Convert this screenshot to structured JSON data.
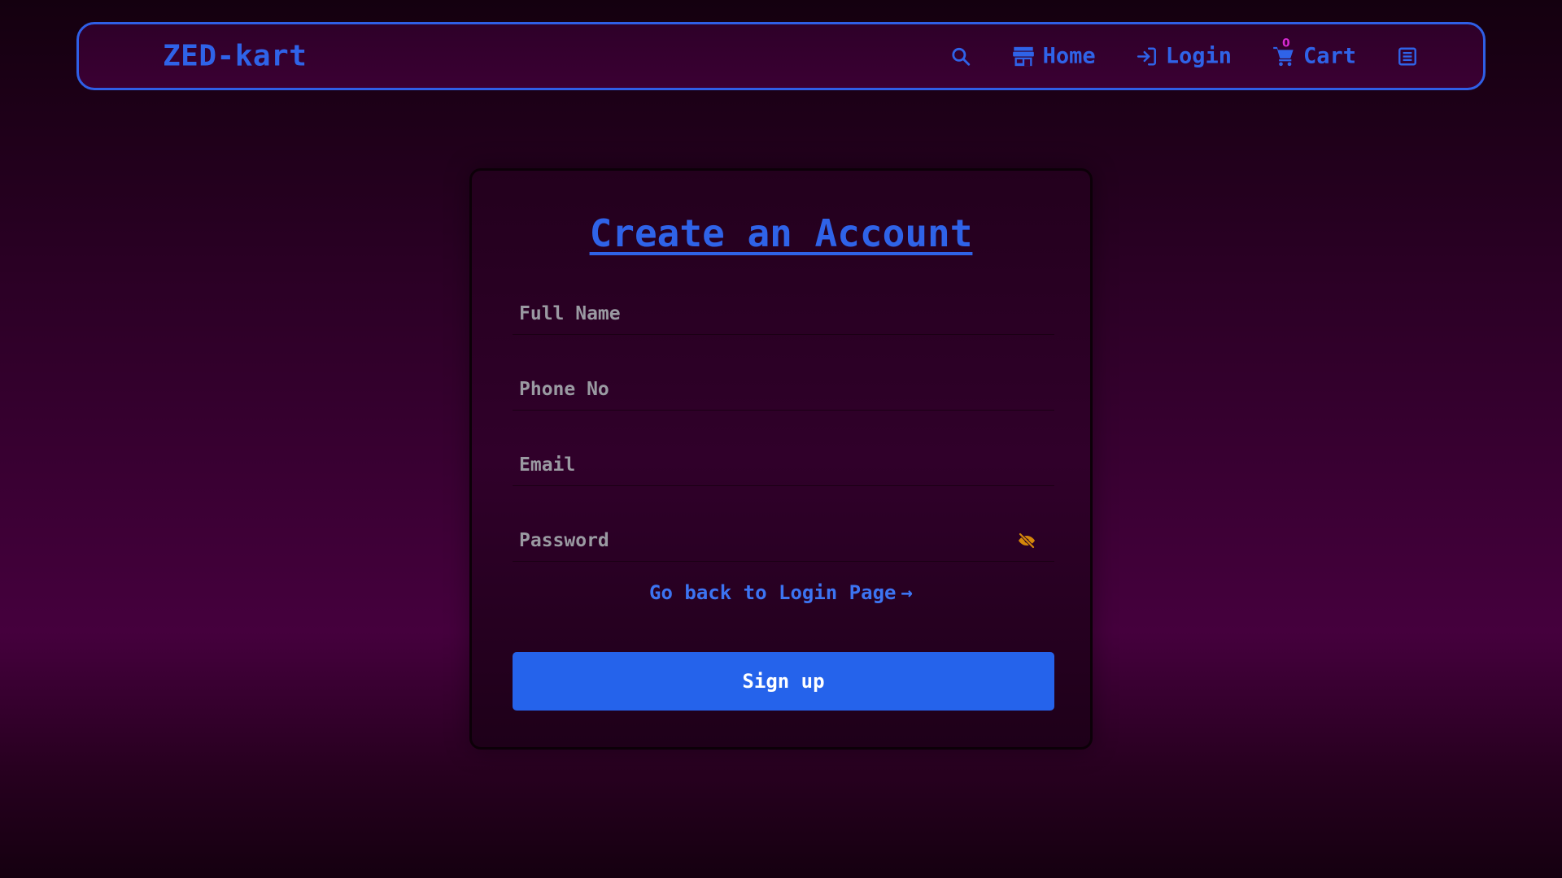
{
  "nav": {
    "brand": "ZED-kart",
    "home_label": "Home",
    "login_label": "Login",
    "cart_label": "Cart",
    "cart_count": "0",
    "icons": {
      "search": "search-icon",
      "home": "store-icon",
      "login": "login-icon",
      "cart": "cart-icon",
      "menu": "list-icon"
    }
  },
  "form": {
    "title": "Create an Account",
    "fields": [
      {
        "placeholder": "Full Name",
        "value": ""
      },
      {
        "placeholder": "Phone No",
        "value": ""
      },
      {
        "placeholder": "Email",
        "value": ""
      },
      {
        "placeholder": "Password",
        "value": ""
      }
    ],
    "back_link": "Go back to Login Page",
    "back_arrow": "→",
    "submit_label": "Sign up"
  },
  "colors": {
    "accent": "#2f63e8",
    "button": "#2563eb",
    "eye_icon": "#d4870a",
    "cart_badge": "#d62ad1"
  }
}
